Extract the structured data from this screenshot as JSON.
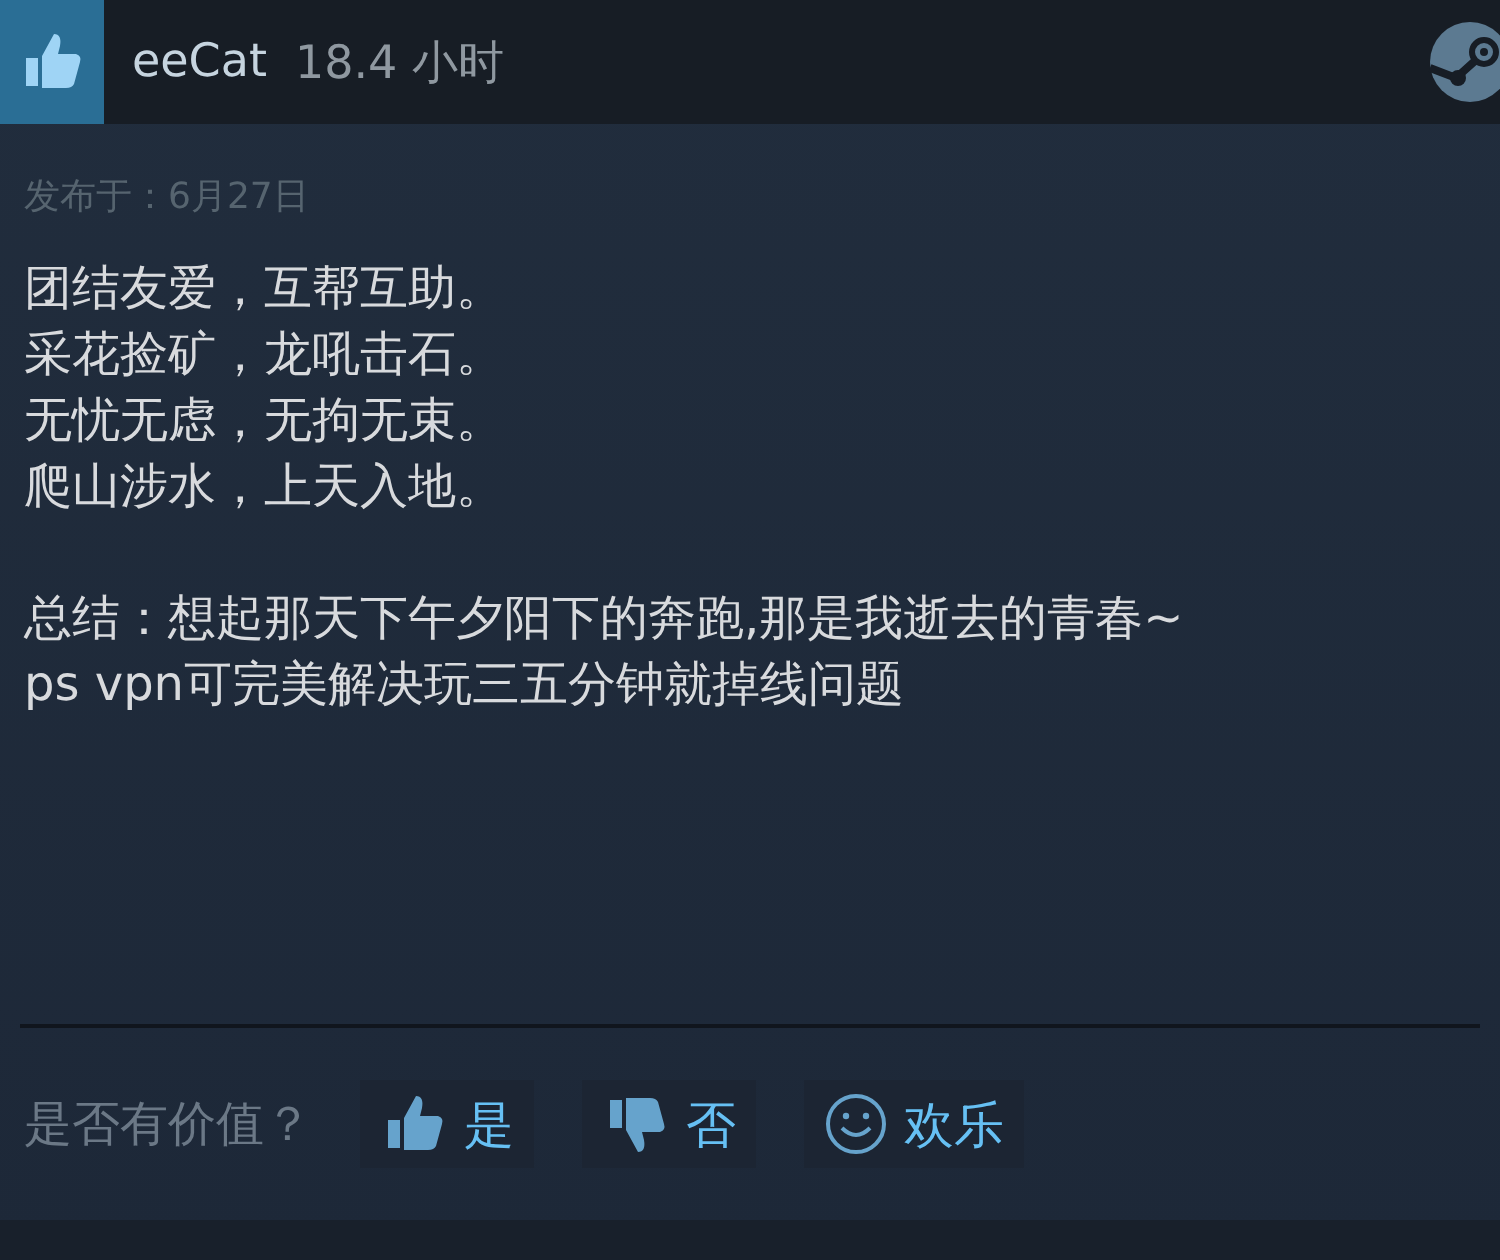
{
  "header": {
    "recommended": true,
    "author": "eeCat",
    "hours": "18.4 小时"
  },
  "posted": "发布于：6月27日",
  "paragraphs": [
    [
      "团结友爱，互帮互助。",
      "采花捡矿，龙吼击石。",
      "无忧无虑，无拘无束。",
      "爬山涉水，上天入地。"
    ],
    [
      "总结：想起那天下午夕阳下的奔跑,那是我逝去的青春~",
      "ps vpn可完美解决玩三五分钟就掉线问题"
    ]
  ],
  "helpful": {
    "question": "是否有价值？",
    "buttons": [
      {
        "kind": "yes",
        "label": "是"
      },
      {
        "kind": "no",
        "label": "否"
      },
      {
        "kind": "funny",
        "label": "欢乐"
      }
    ]
  }
}
